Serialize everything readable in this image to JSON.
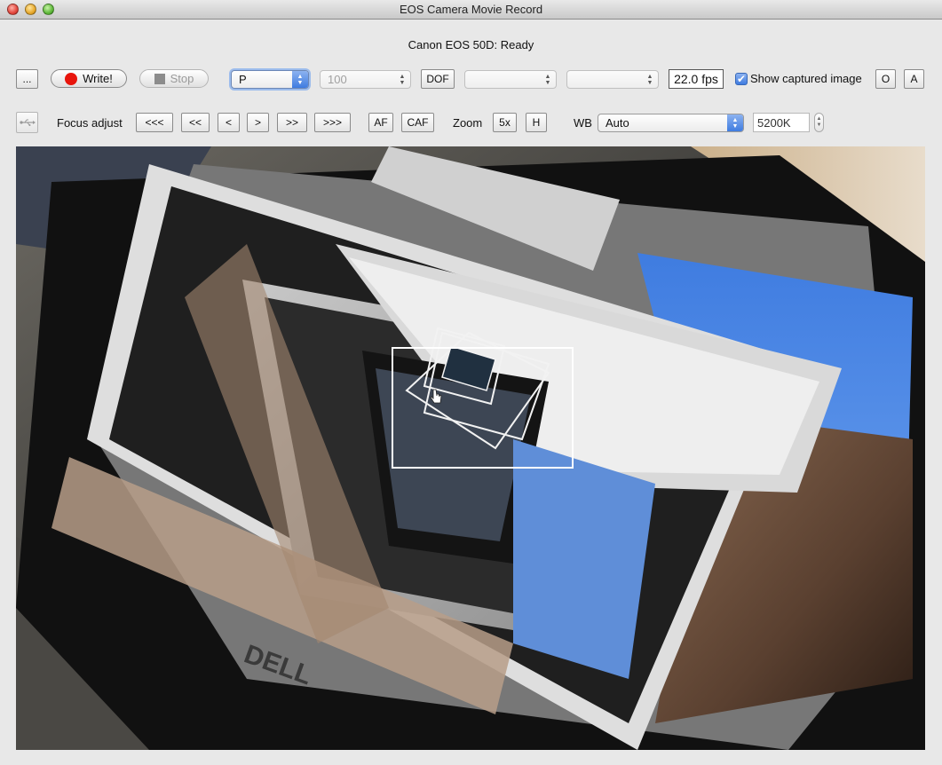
{
  "window": {
    "title": "EOS Camera Movie Record"
  },
  "status": "Canon EOS 50D: Ready",
  "toolbar1": {
    "more_button": "...",
    "write_button": "Write!",
    "stop_button": "Stop",
    "mode_select": "P",
    "iso_select": "100",
    "dof_button": "DOF",
    "aperture_select": "",
    "shutter_select": "",
    "fps": "22.0 fps",
    "show_captured_label": "Show captured image",
    "show_captured_checked": true,
    "o_button": "O",
    "a_button": "A"
  },
  "toolbar2": {
    "focus_label": "Focus adjust",
    "focus_buttons": [
      "<<<",
      "<<",
      "<",
      ">",
      ">>",
      ">>>"
    ],
    "af_button": "AF",
    "caf_button": "CAF",
    "zoom_label": "Zoom",
    "zoom_5x_button": "5x",
    "zoom_h_button": "H",
    "wb_label": "WB",
    "wb_select": "Auto",
    "kelvin_value": "5200K"
  },
  "colors": {
    "record_red": "#e8150c",
    "accent_blue": "#3f7ce0"
  },
  "icons": {
    "usb": "usb-icon",
    "record": "record-dot-icon",
    "stop": "stop-square-icon",
    "cursor": "hand-cursor-icon"
  }
}
